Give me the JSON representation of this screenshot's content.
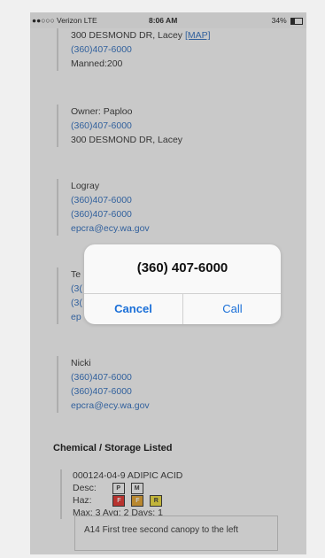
{
  "status_bar": {
    "carrier": "●●○○○ Verizon  LTE",
    "time": "8:06 AM",
    "battery": "34%"
  },
  "facility_block": {
    "address_line": "300 DESMOND DR, Lacey",
    "map_link": "[MAP]",
    "phone": "(360)407-6000",
    "manned": "Manned:200"
  },
  "owner_block": {
    "owner": "Owner: Paploo",
    "phone": "(360)407-6000",
    "address": "300 DESMOND DR, Lacey"
  },
  "contact_1": {
    "name": "Logray",
    "phone_1": "(360)407-6000",
    "phone_2": "(360)407-6000",
    "email": "epcra@ecy.wa.gov"
  },
  "contact_2": {
    "name_partial": "Te",
    "phone_partial_1": "(3(",
    "phone_partial_2": "(3(",
    "email_partial": "ep"
  },
  "contact_3": {
    "name": "Nicki",
    "phone_1": "(360)407-6000",
    "phone_2": "(360)407-6000",
    "email": "epcra@ecy.wa.gov"
  },
  "chemicals": {
    "section_title": "Chemical / Storage Listed",
    "item": "000124-04-9 ADIPIC ACID",
    "desc_label": "Desc:",
    "desc_tags": [
      "P",
      "M"
    ],
    "haz_label": "Haz:",
    "haz_tags": [
      "F",
      "F",
      "R"
    ],
    "amounts": "Max: 3 Avg: 2 Days: 1",
    "note": "A14   First tree second canopy to the left"
  },
  "alert": {
    "title": "(360) 407-6000",
    "cancel_label": "Cancel",
    "call_label": "Call"
  },
  "colors": {
    "link": "#2e6fc2",
    "alert_button": "#1a6fd8",
    "haz_red": "#e8302a",
    "haz_orange": "#e9a52b",
    "haz_yellow": "#f4e23a"
  }
}
